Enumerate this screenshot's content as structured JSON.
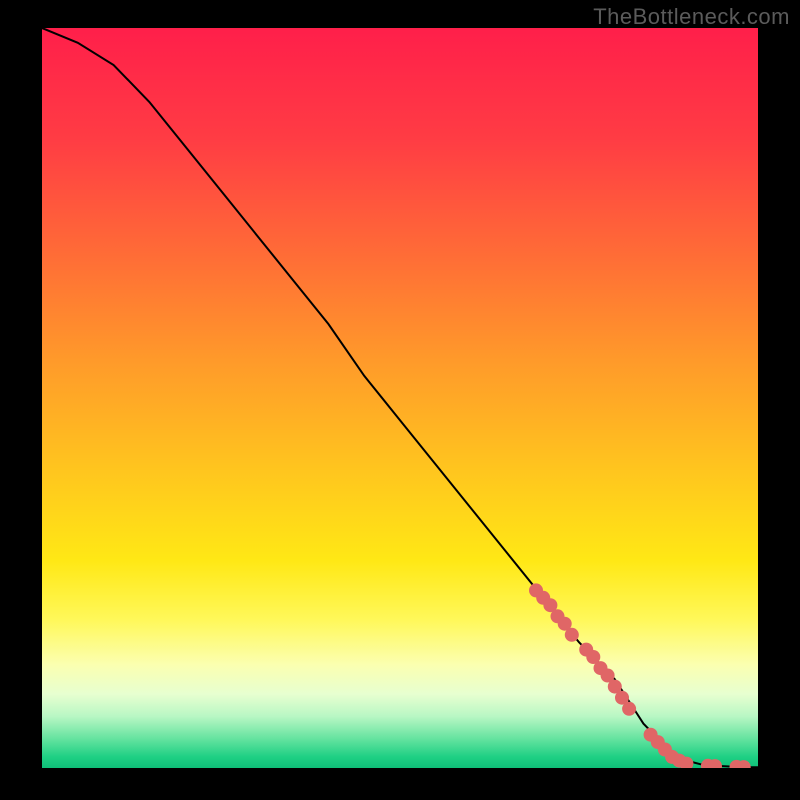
{
  "watermark": "TheBottleneck.com",
  "chart_data": {
    "type": "line",
    "title": "",
    "xlabel": "",
    "ylabel": "",
    "xlim": [
      0,
      100
    ],
    "ylim": [
      0,
      100
    ],
    "curve": {
      "name": "main-curve",
      "x": [
        0,
        5,
        10,
        15,
        20,
        25,
        30,
        35,
        40,
        45,
        50,
        55,
        60,
        65,
        70,
        75,
        80,
        82,
        84,
        86,
        88,
        90,
        92,
        94,
        96,
        98,
        100
      ],
      "y": [
        100,
        98,
        95,
        90,
        84,
        78,
        72,
        66,
        60,
        53,
        47,
        41,
        35,
        29,
        23,
        17,
        12,
        9,
        6,
        4,
        2,
        1,
        0.5,
        0.3,
        0.2,
        0.1,
        0.1
      ]
    },
    "highlight_points": {
      "name": "highlight",
      "color": "#e06666",
      "x": [
        69,
        70,
        71,
        72,
        73,
        74,
        76,
        77,
        78,
        79,
        80,
        81,
        82,
        85,
        86,
        87,
        88,
        89,
        90,
        93,
        94,
        97,
        98
      ],
      "y": [
        24,
        23,
        22,
        20.5,
        19.5,
        18,
        16,
        15,
        13.5,
        12.5,
        11,
        9.5,
        8,
        4.5,
        3.5,
        2.5,
        1.5,
        1,
        0.6,
        0.3,
        0.25,
        0.15,
        0.12
      ]
    },
    "background_gradient_stops": [
      {
        "offset": 0.0,
        "color": "#ff1f4a"
      },
      {
        "offset": 0.15,
        "color": "#ff3c44"
      },
      {
        "offset": 0.3,
        "color": "#ff6a37"
      },
      {
        "offset": 0.45,
        "color": "#ff9a2a"
      },
      {
        "offset": 0.6,
        "color": "#ffc61e"
      },
      {
        "offset": 0.72,
        "color": "#ffe815"
      },
      {
        "offset": 0.8,
        "color": "#fff85a"
      },
      {
        "offset": 0.86,
        "color": "#fbffb0"
      },
      {
        "offset": 0.9,
        "color": "#e7ffd0"
      },
      {
        "offset": 0.93,
        "color": "#b9f7c4"
      },
      {
        "offset": 0.96,
        "color": "#66e3a0"
      },
      {
        "offset": 0.985,
        "color": "#1fd084"
      },
      {
        "offset": 1.0,
        "color": "#0fbf78"
      }
    ]
  }
}
